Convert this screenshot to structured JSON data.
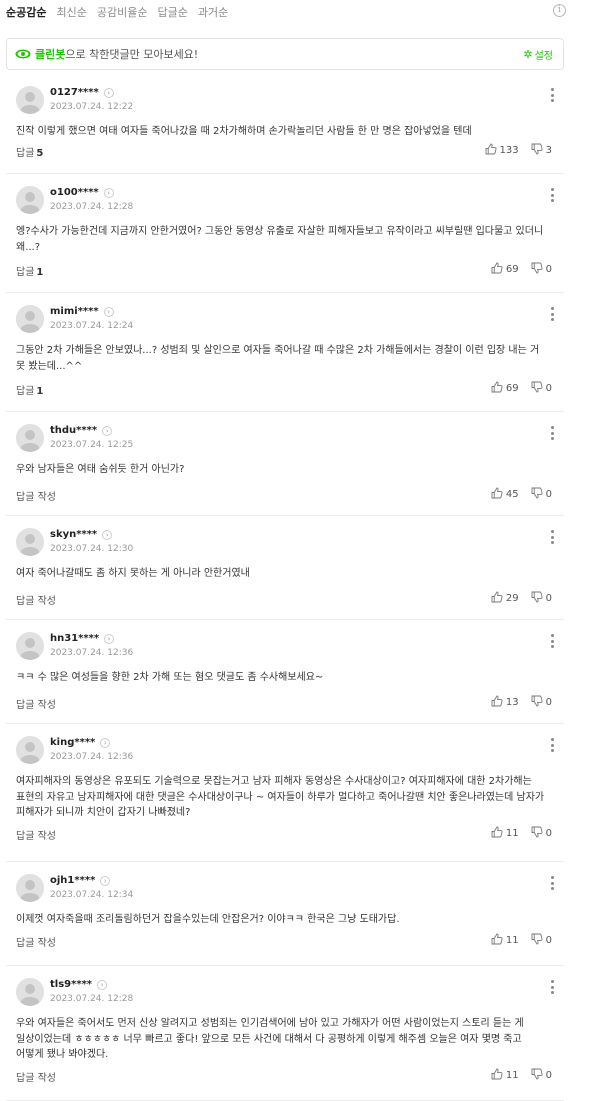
{
  "sort": {
    "items": [
      "순공감순",
      "최신순",
      "공감비율순",
      "답글순",
      "과거순"
    ],
    "active_index": 0
  },
  "cleanbot": {
    "brand": "클린봇",
    "text": "으로 착한댓글만 모아보세요!",
    "setting": "설정",
    "color": "#1ec800"
  },
  "comments": [
    {
      "user": "0127****",
      "date": "2023.07.24. 12:22",
      "text": "진작 이렇게 했으면 여태 여자들 죽어나갔을 때 2차가해하며 손가락놀리던 사람들 한 만 명은 잡아넣었을 텐데",
      "reply_label": "답글",
      "reply_count": "5",
      "likes": "133",
      "dislikes": "3"
    },
    {
      "user": "o100****",
      "date": "2023.07.24. 12:28",
      "text": "엥?수사가 가능한건데 지금까지 안한거였어? 그동안 동영상 유출로 자살한 피해자들보고 유작이라고 씨부릴땐 입다물고 있더니 왜...?",
      "reply_label": "답글",
      "reply_count": "1",
      "likes": "69",
      "dislikes": "0"
    },
    {
      "user": "mimi****",
      "date": "2023.07.24. 12:24",
      "text": "그동안 2차 가해들은 안보였나...? 성범죄 및 살인으로 여자들 죽어나갈 때 수많은 2차 가해들에서는 경찰이 이런 입장 내는 거 못 봤는데...^^",
      "reply_label": "답글",
      "reply_count": "1",
      "likes": "69",
      "dislikes": "0"
    },
    {
      "user": "thdu****",
      "date": "2023.07.24. 12:25",
      "text": "우와 남자들은 여태 숨쉬듯 한거 아닌가?",
      "reply_label": "답글 작성",
      "reply_count": "",
      "likes": "45",
      "dislikes": "0"
    },
    {
      "user": "skyn****",
      "date": "2023.07.24. 12:30",
      "text": "여자 죽어나갈때도 좀 하지 못하는 게 아니라 안한거였내",
      "reply_label": "답글 작성",
      "reply_count": "",
      "likes": "29",
      "dislikes": "0"
    },
    {
      "user": "hn31****",
      "date": "2023.07.24. 12:36",
      "text": "ㅋㅋ 수 많은 여성들을 향한 2차 가해 또는 혐오 댓글도 좀 수사해보세요~",
      "reply_label": "답글 작성",
      "reply_count": "",
      "likes": "13",
      "dislikes": "0"
    },
    {
      "user": "king****",
      "date": "2023.07.24. 12:36",
      "text": "여자피해자의 동영상은 유포되도 기술력으로 못잡는거고 남자 피해자 동영상은 수사대상이고? 여자피해자에 대한 2차가해는 표현의 자유고 남자피해자에 대한 댓글은 수사대상이구나 ~ 여자들이 하루가 멀다하고 죽어나갈땐 치안 좋은나라였는데 남자가 피해자가 되니까 치안이 갑자기 나빠졌네?",
      "reply_label": "답글 작성",
      "reply_count": "",
      "likes": "11",
      "dislikes": "0"
    },
    {
      "user": "ojh1****",
      "date": "2023.07.24. 12:34",
      "text": "이제껏 여자죽을때 조리돌림하던거 잡을수있는데 안잡은거? 이야ㅋㅋ 한국은 그냥 도태가답.",
      "reply_label": "답글 작성",
      "reply_count": "",
      "likes": "11",
      "dislikes": "0"
    },
    {
      "user": "tls9****",
      "date": "2023.07.24. 12:28",
      "text": "우와 여자들은 죽어서도 먼저 신상 알려지고 성범죄는 인기검색어에 남아 있고 가해자가 어떤 사람이었는지 스토리 듣는 게 일상이었는데 ㅎㅎㅎㅎㅎ 너무 빠르고 좋다! 앞으로 모든 사건에 대해서 다 공평하게 이렇게 해주셈 오늘은 여자 몇명 죽고 어떻게 됐나 봐야겠다.",
      "reply_label": "답글 작성",
      "reply_count": "",
      "likes": "11",
      "dislikes": "0"
    }
  ]
}
